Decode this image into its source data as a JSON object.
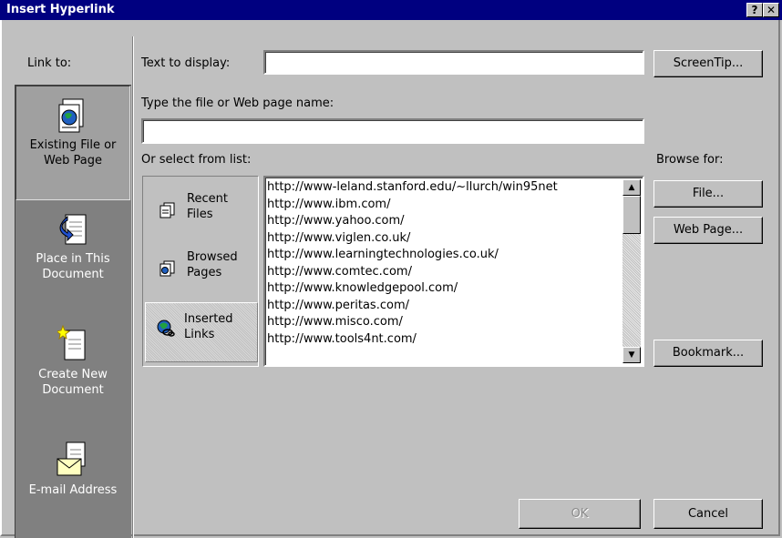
{
  "window": {
    "title": "Insert Hyperlink",
    "help_btn": "?",
    "close_btn": "✕"
  },
  "link_to": {
    "label": "Link to:",
    "items": [
      {
        "line1": "Existing File or",
        "line2": "Web Page"
      },
      {
        "line1": "Place in This",
        "line2": "Document"
      },
      {
        "line1": "Create New",
        "line2": "Document"
      },
      {
        "line1": "E-mail Address",
        "line2": ""
      }
    ]
  },
  "text_to_display": {
    "label": "Text to display:",
    "value": ""
  },
  "screentip_button": "ScreenTip...",
  "file_name": {
    "label": "Type the file or Web page name:",
    "value": ""
  },
  "select_label": "Or select from list:",
  "browse": {
    "label": "Browse for:",
    "file_button": "File...",
    "webpage_button": "Web Page..."
  },
  "bookmark_button": "Bookmark...",
  "sources": [
    {
      "line1": "Recent",
      "line2": "Files"
    },
    {
      "line1": "Browsed",
      "line2": "Pages"
    },
    {
      "line1": "Inserted",
      "line2": "Links"
    }
  ],
  "urls": [
    "http://www-leland.stanford.edu/~llurch/win95net",
    "http://www.ibm.com/",
    "http://www.yahoo.com/",
    "http://www.viglen.co.uk/",
    "http://www.learningtechnologies.co.uk/",
    "http://www.comtec.com/",
    "http://www.knowledgepool.com/",
    "http://www.peritas.com/",
    "http://www.misco.com/",
    "http://www.tools4nt.com/"
  ],
  "ok_button": "OK",
  "cancel_button": "Cancel"
}
